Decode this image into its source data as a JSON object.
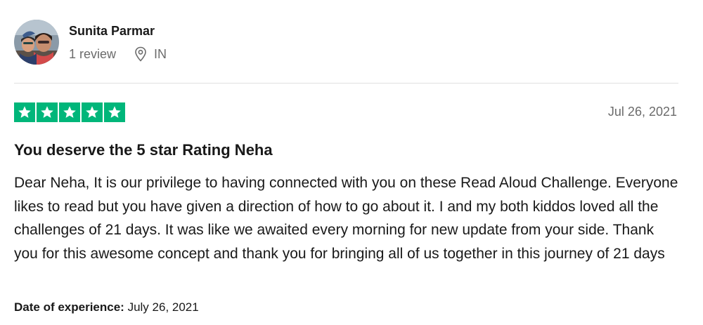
{
  "reviewer": {
    "name": "Sunita Parmar",
    "review_count": "1 review",
    "country": "IN"
  },
  "review": {
    "rating": 5,
    "rating_max": 5,
    "date": "Jul 26, 2021",
    "title": "You deserve the 5 star Rating Neha",
    "body": "Dear Neha, It is our privilege to having connected with you on these Read Aloud Challenge. Everyone likes to read but you have given a direction of how to go about it. I and my both kiddos loved all the challenges of 21 days. It was like we awaited every morning for new update from your side. Thank you for this awesome concept and thank you for bringing all of us together in this journey of 21 days",
    "experience_label": "Date of experience:",
    "experience_date": "July 26, 2021"
  },
  "icons": {
    "location": "location-pin-icon",
    "star": "star-icon",
    "avatar": "avatar-photo"
  },
  "colors": {
    "star_green": "#00b67a",
    "text_primary": "#191919",
    "text_secondary": "#6b6b6b",
    "divider": "#e0e0e0"
  }
}
